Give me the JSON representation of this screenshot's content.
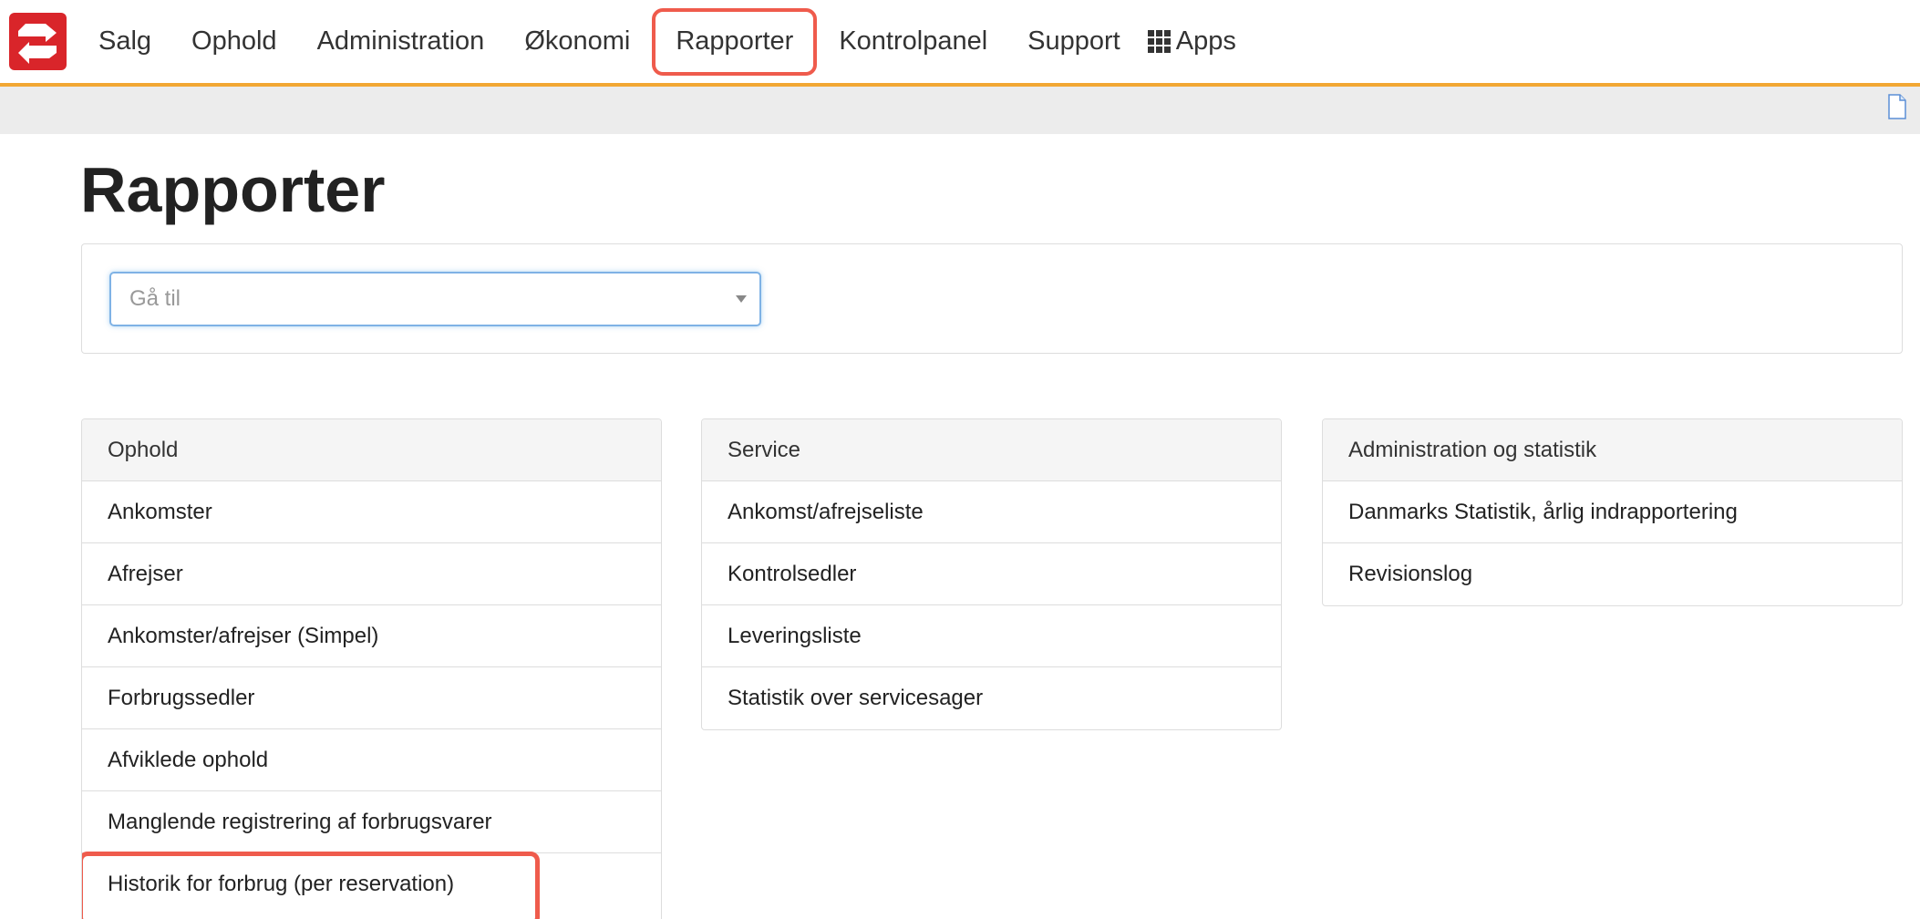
{
  "colors": {
    "accent_orange": "#f2a733",
    "logo_red": "#d9252a",
    "highlight_red": "#ef5b4c",
    "focus_blue": "#7fb2e5"
  },
  "nav": {
    "items": [
      {
        "label": "Salg"
      },
      {
        "label": "Ophold"
      },
      {
        "label": "Administration"
      },
      {
        "label": "Økonomi"
      },
      {
        "label": "Rapporter",
        "active": true
      },
      {
        "label": "Kontrolpanel"
      },
      {
        "label": "Support"
      },
      {
        "label": "Apps",
        "icon": "grid-icon"
      }
    ]
  },
  "page": {
    "title": "Rapporter"
  },
  "goto": {
    "placeholder": "Gå til"
  },
  "panels": {
    "ophold": {
      "heading": "Ophold",
      "items": [
        "Ankomster",
        "Afrejser",
        "Ankomster/afrejser (Simpel)",
        "Forbrugssedler",
        "Afviklede ophold",
        "Manglende registrering af forbrugsvarer",
        "Historik for forbrug (per reservation)"
      ]
    },
    "service": {
      "heading": "Service",
      "items": [
        "Ankomst/afrejseliste",
        "Kontrolsedler",
        "Leveringsliste",
        "Statistik over servicesager"
      ]
    },
    "admin": {
      "heading": "Administration og statistik",
      "items": [
        "Danmarks Statistik, årlig indrapportering",
        "Revisionslog"
      ]
    }
  }
}
